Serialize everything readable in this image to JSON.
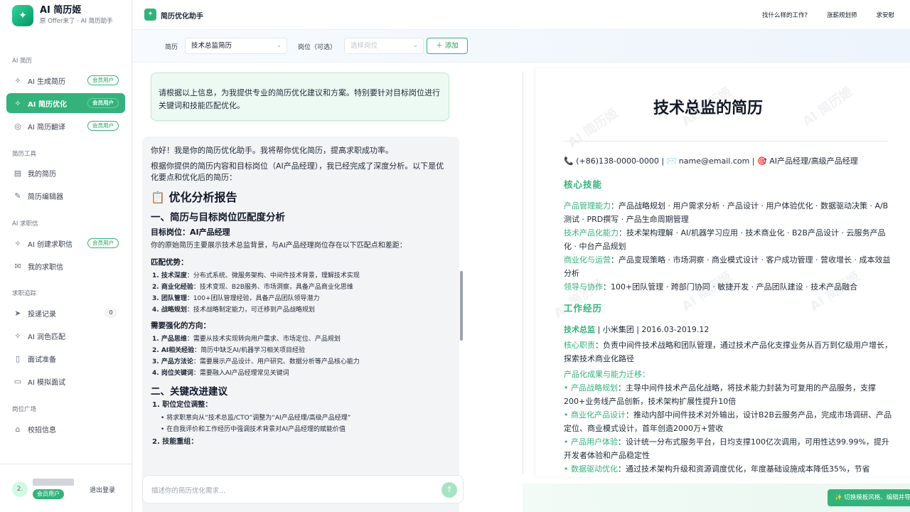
{
  "brand": {
    "title": "AI 简历姬",
    "subtitle": "原 Offer来了 · AI 简历助手"
  },
  "sidebar": {
    "sections": [
      "AI 简历",
      "简历工具",
      "AI 求职信",
      "求职追踪",
      "岗位广场"
    ],
    "items": [
      {
        "label": "AI 生成简历",
        "badge": "会员用户",
        "icon": "sparkle-icon"
      },
      {
        "label": "AI 简历优化",
        "badge": "会员用户",
        "icon": "sparkle-icon",
        "active": true
      },
      {
        "label": "AI 简历翻译",
        "badge": "会员用户",
        "icon": "globe-icon"
      },
      {
        "label": "我的简历",
        "icon": "document-icon"
      },
      {
        "label": "简历编辑器",
        "icon": "pencil-icon"
      },
      {
        "label": "AI 创建求职信",
        "badge": "会员用户",
        "icon": "sparkle-icon"
      },
      {
        "label": "我的求职信",
        "icon": "mail-icon"
      },
      {
        "label": "投递记录",
        "count": "0",
        "icon": "send-icon"
      },
      {
        "label": "AI 润色匹配",
        "icon": "sparkle-icon"
      },
      {
        "label": "面试准备",
        "icon": "book-icon"
      },
      {
        "label": "AI 模拟面试",
        "icon": "video-icon"
      },
      {
        "label": "校招信息",
        "icon": "graduation-icon"
      }
    ],
    "user": {
      "avatar": "2.",
      "badge": "会员用户",
      "logout": "退出登录"
    }
  },
  "topbar": {
    "title": "简历优化助手",
    "links": [
      "找什么样的工作?",
      "涨薪规划师",
      "求安慰"
    ]
  },
  "filter": {
    "resume_label": "简历",
    "resume_value": "技术总监简历",
    "job_label": "岗位（可选）",
    "job_placeholder": "选择岗位",
    "add_label": "添加"
  },
  "chat": {
    "user_message": "请根据以上信息，为我提供专业的简历优化建议和方案。特别要针对目标岗位进行关键词和技能匹配优化。",
    "greeting": "你好！我是你的简历优化助手。我将帮你优化简历，提高求职成功率。",
    "intro": "根据你提供的简历内容和目标岗位（AI产品经理），我已经完成了深度分析。以下是优化要点和优化后的简历：",
    "report_title": "📋 优化分析报告",
    "section1": "一、简历与目标岗位匹配度分析",
    "target": "目标岗位：AI产品经理",
    "original": "你的原始简历主要展示技术总监背景，与AI产品经理岗位存在以下匹配点和差距：",
    "adv_title": "匹配优势：",
    "advantages": [
      {
        "k": "1. 技术深度",
        "v": "：分布式系统、微服务架构、中间件技术背景，理解技术实现"
      },
      {
        "k": "2. 商业化经验",
        "v": "：技术变现、B2B服务、市场洞察，具备产品商业化思维"
      },
      {
        "k": "3. 团队管理",
        "v": "：100+团队管理经验，具备产品团队领导潜力"
      },
      {
        "k": "4. 战略规划",
        "v": "：技术战略制定能力，可迁移到产品战略规划"
      }
    ],
    "improve_title": "需要强化的方向：",
    "improvements": [
      {
        "k": "1. 产品思维",
        "v": "：需要从技术实现转向用户需求、市场定位、产品规划"
      },
      {
        "k": "2. AI相关经验",
        "v": "：简历中缺乏AI/机器学习相关项目经验"
      },
      {
        "k": "3. 产品方法论",
        "v": "：需要展示产品设计、用户研究、数据分析等产品核心能力"
      },
      {
        "k": "4. 岗位关键词",
        "v": "：需要融入AI产品经理常见关键词"
      }
    ],
    "section2": "二、关键改进建议",
    "s2_item1": "1. 职位定位调整：",
    "s2_sub": [
      "将求职意向从“技术总监/CTO”调整为“AI产品经理/高级产品经理”",
      "在自我评价和工作经历中强调技术背景对AI产品经理的赋能价值"
    ],
    "s2_item2": "2. 技能重组：",
    "input_placeholder": "描述你的简历优化需求..."
  },
  "resume": {
    "title": "技术总监的简历",
    "contact": "📞 (+86)138-0000-0000 | ✉️ name@email.com | 🎯 AI产品经理/高级产品经理",
    "watermark": "AI 简历姬",
    "skills_heading": "核心技能",
    "skills": [
      {
        "k": "产品管理能力",
        "v": "：产品战略规划 · 用户需求分析 · 产品设计 · 用户体验优化 · 数据驱动决策 · A/B测试 · PRD撰写 · 产品生命周期管理"
      },
      {
        "k": "技术产品化能力",
        "v": "：技术架构理解 · AI/机器学习应用 · 技术商业化 · B2B产品设计 · 云服务产品化 · 中台产品规划"
      },
      {
        "k": "商业化与运营",
        "v": "：产品变现策略 · 市场洞察 · 商业模式设计 · 客户成功管理 · 营收增长 · 成本效益分析"
      },
      {
        "k": "领导与协作",
        "v": "：100+团队管理 · 跨部门协同 · 敏捷开发 · 产品团队建设 · 技术产品融合"
      }
    ],
    "work_heading": "工作经历",
    "job_title": "技术总监",
    "job_meta": " | 小米集团 | 2016.03-2019.12",
    "duty_k": "核心职责",
    "duty_v": "：负责中间件技术战略和团队管理，通过技术产品化支撑业务从百万到亿级用户增长，探索技术商业化路径",
    "achieve_heading": "产品化成果与能力迁移：",
    "achievements": [
      {
        "k": "产品战略规划",
        "v": "：主导中间件技术产品化战略，将技术能力封装为可复用的产品服务，支撑200+业务线产品创新，技术架构扩展性提升10倍"
      },
      {
        "k": "商业化产品设计",
        "v": "：推动内部中间件技术对外输出，设计B2B云服务产品，完成市场调研、产品定位、商业模式设计，首年创造2000万+营收"
      },
      {
        "k": "产品用户体验",
        "v": "：设计统一分布式服务平台，日均支撑100亿次调用，可用性达99.99%，提升开发者体验和产品稳定性"
      },
      {
        "k": "数据驱动优化",
        "v": "：通过技术架构升级和资源调度优化，年度基础设施成本降低35%，节省"
      }
    ]
  },
  "switch_label": "✨ 切换模板风格、编辑并导出"
}
